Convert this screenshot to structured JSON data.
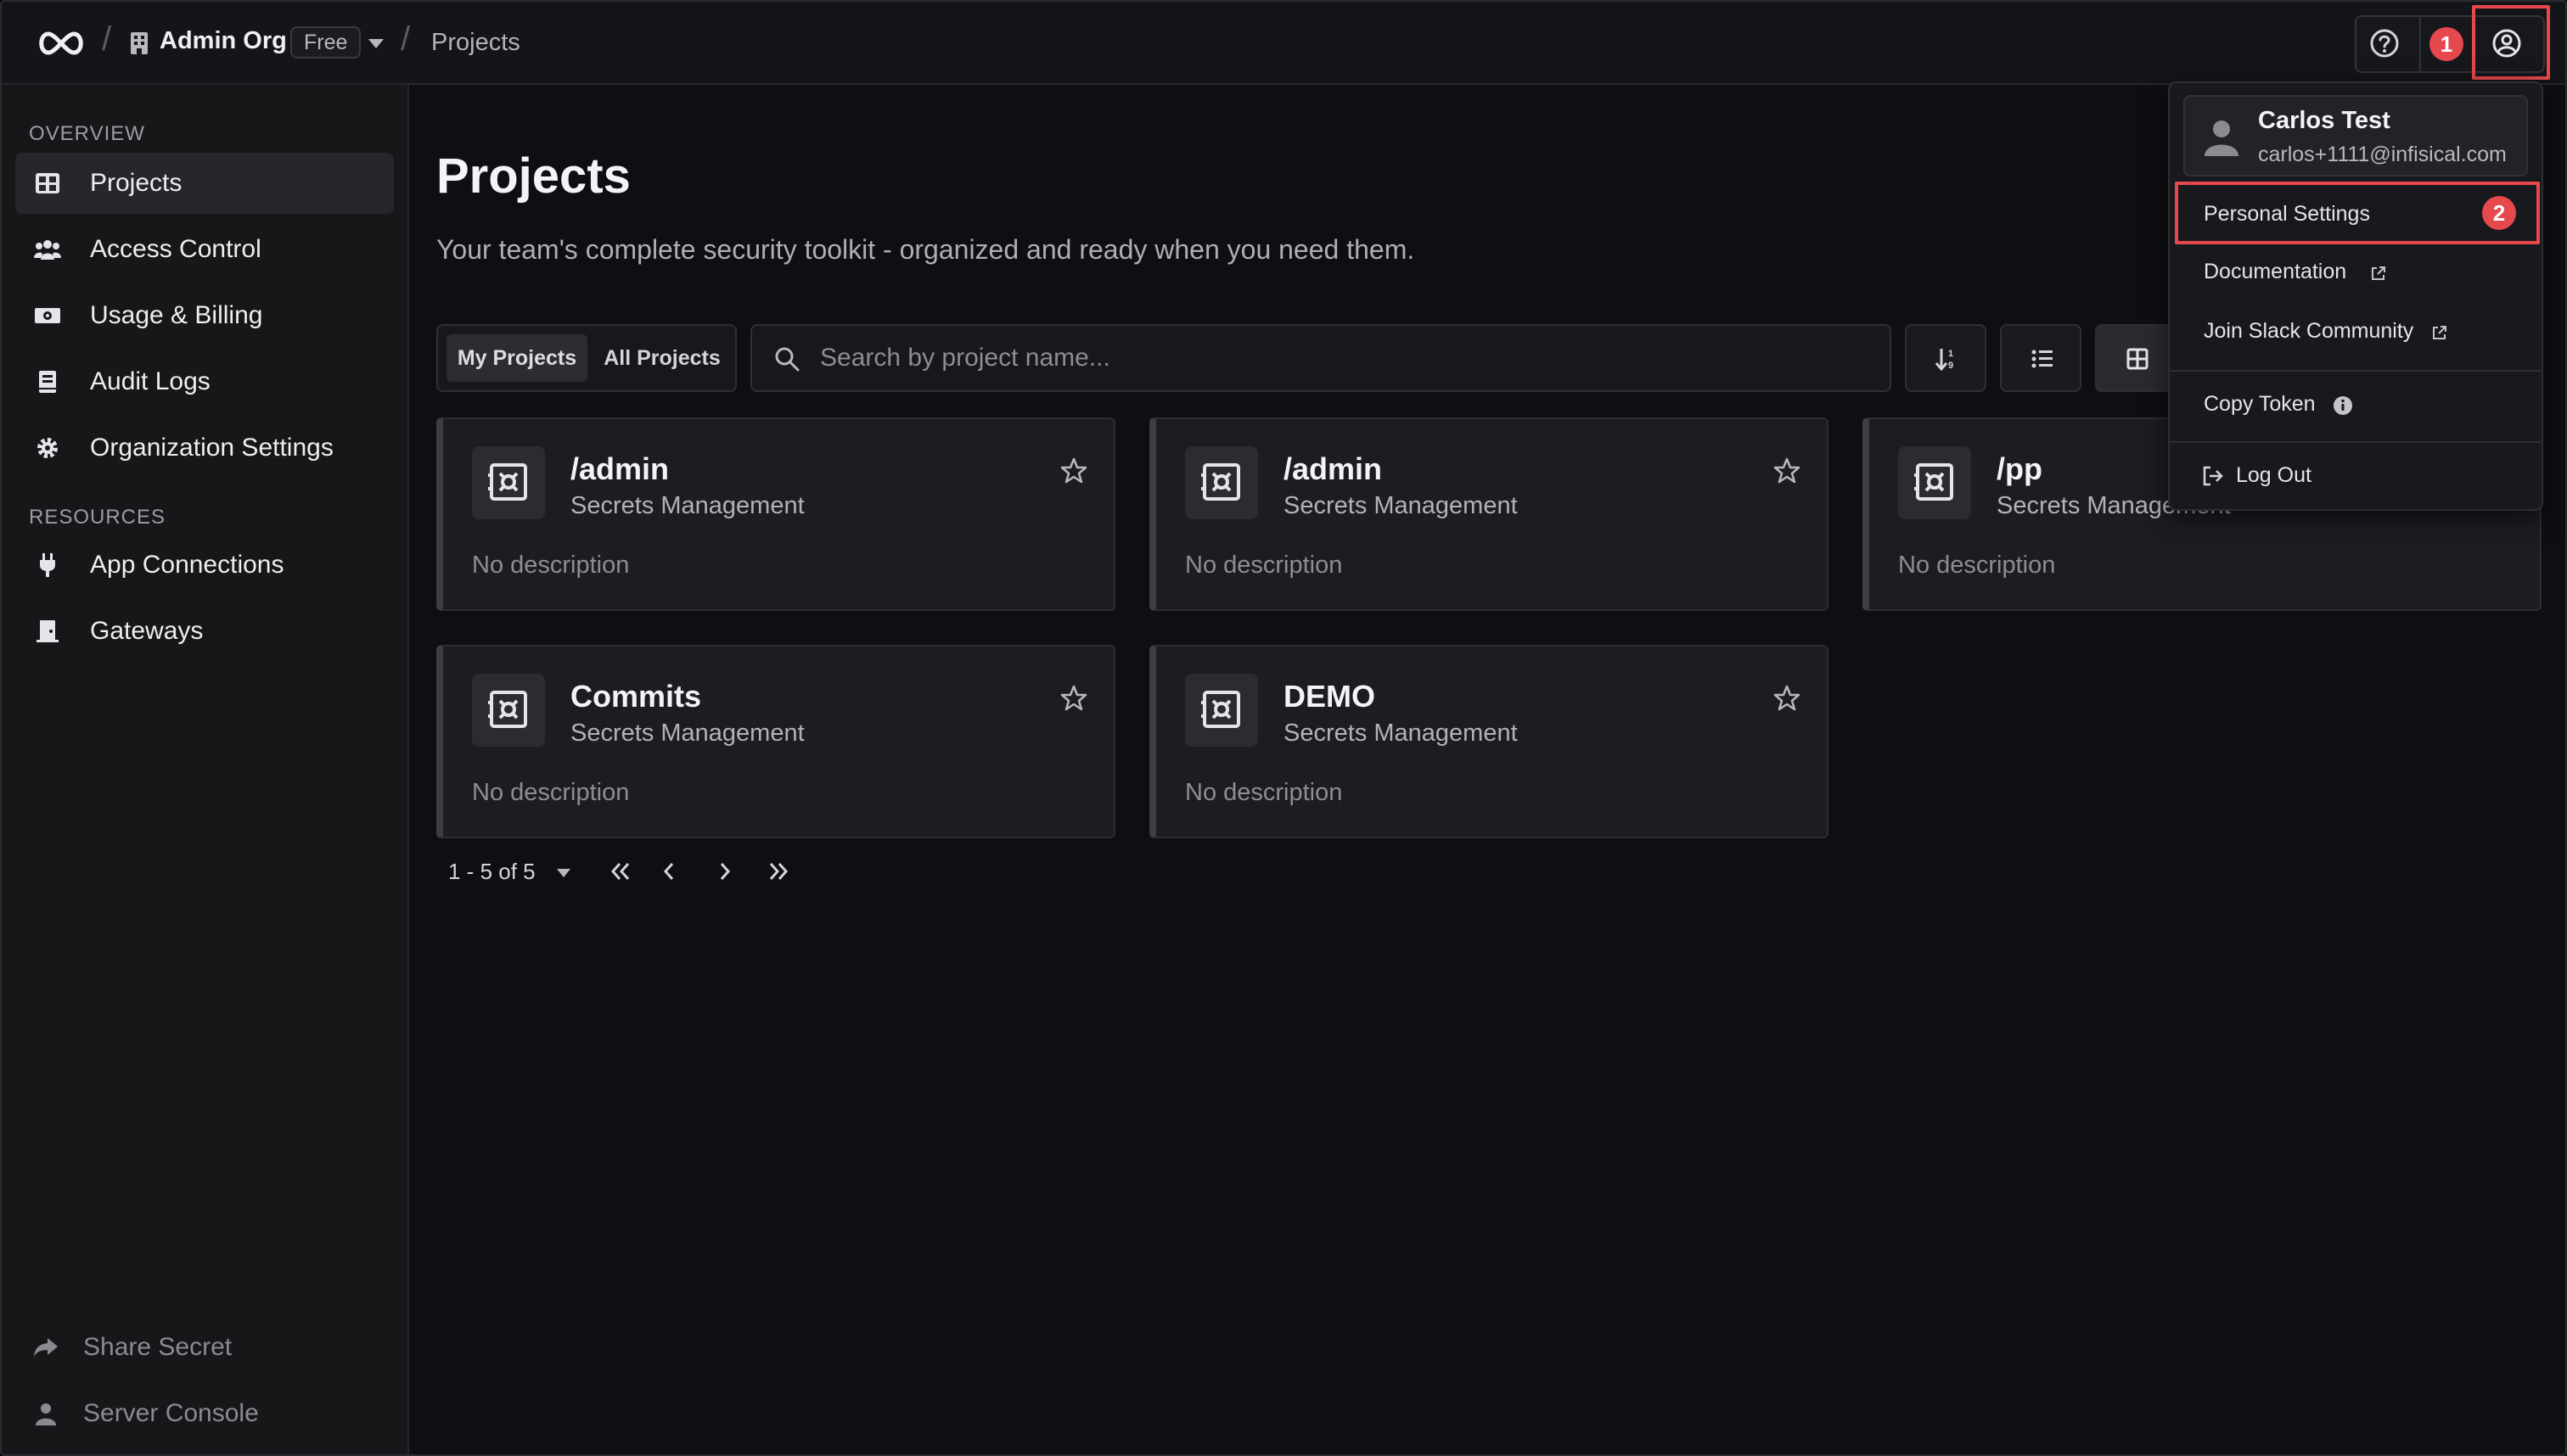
{
  "topbar": {
    "org_name": "Admin Org",
    "plan": "Free",
    "breadcrumb": "Projects",
    "marker_1": "1"
  },
  "sidebar": {
    "overview_label": "OVERVIEW",
    "resources_label": "RESOURCES",
    "items": [
      {
        "label": "Projects",
        "icon": "grid-icon"
      },
      {
        "label": "Access Control",
        "icon": "users-icon"
      },
      {
        "label": "Usage & Billing",
        "icon": "money-icon"
      },
      {
        "label": "Audit Logs",
        "icon": "book-icon"
      },
      {
        "label": "Organization Settings",
        "icon": "gear-icon"
      }
    ],
    "resource_items": [
      {
        "label": "App Connections",
        "icon": "plug-icon"
      },
      {
        "label": "Gateways",
        "icon": "door-icon"
      }
    ],
    "bottom_items": [
      {
        "label": "Share Secret",
        "icon": "share-icon"
      },
      {
        "label": "Server Console",
        "icon": "user-icon"
      }
    ]
  },
  "main": {
    "title": "Projects",
    "subtitle": "Your team's complete security toolkit - organized and ready when you need them.",
    "tabs": [
      {
        "label": "My Projects"
      },
      {
        "label": "All Projects"
      }
    ],
    "search_placeholder": "Search by project name..."
  },
  "projects": [
    {
      "title": "/admin",
      "type": "Secrets Management",
      "description": "No description"
    },
    {
      "title": "/admin",
      "type": "Secrets Management",
      "description": "No description"
    },
    {
      "title": "/pp",
      "type": "Secrets Management",
      "description": "No description"
    },
    {
      "title": "Commits",
      "type": "Secrets Management",
      "description": "No description"
    },
    {
      "title": "DEMO",
      "type": "Secrets Management",
      "description": "No description"
    }
  ],
  "pagination": {
    "label": "1 - 5 of 5"
  },
  "dropdown": {
    "user_name": "Carlos Test",
    "user_email": "carlos+1111@infisical.com",
    "personal_settings": "Personal Settings",
    "marker_2": "2",
    "documentation": "Documentation",
    "slack": "Join Slack Community",
    "copy_token": "Copy Token",
    "logout": "Log Out"
  },
  "colors": {
    "accent_marker": "#e5484d",
    "background": "#0e0f12",
    "sidebar": "#161719"
  }
}
